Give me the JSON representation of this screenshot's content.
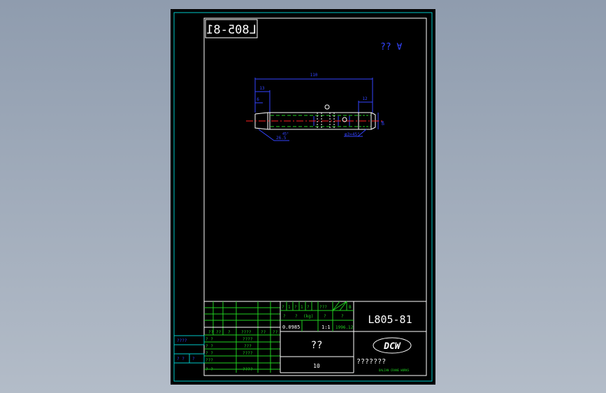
{
  "drawing": {
    "code_mirrored": "L805-81",
    "top_right_mark": "?? ∀",
    "dims": {
      "overall": "110",
      "left_len": "13",
      "left_small": "6",
      "right_len": "12",
      "right_dia": "φ8",
      "left_angle": "45°",
      "left_dia": "26.5",
      "right_note": "φ3×45°"
    }
  },
  "title_block": {
    "header_cells": [
      "?",
      "1",
      "?",
      "1",
      "?",
      "???",
      "",
      "B"
    ],
    "row2": [
      "?",
      "?",
      "(kg)",
      "?",
      "?"
    ],
    "weight": "0.0985",
    "scale": "1:1",
    "date": "1996.12",
    "part_no": "L805-81",
    "part_name": "??",
    "material": "10",
    "company_logo": "DCW",
    "company_name": "???????",
    "company_sub": "DALIAN CRANE WORKS",
    "rev_header": [
      "??",
      "??",
      "?",
      "????",
      "??",
      "??"
    ],
    "sign_rows": [
      {
        "role": "? ?",
        "name": "????"
      },
      {
        "role": "? ?",
        "name": "???"
      },
      {
        "role": "? ?",
        "name": "????"
      },
      {
        "role": "???",
        "name": ""
      },
      {
        "role": "? ?",
        "name": "????"
      }
    ],
    "side_labels": [
      "????",
      "? ?",
      "?"
    ]
  }
}
